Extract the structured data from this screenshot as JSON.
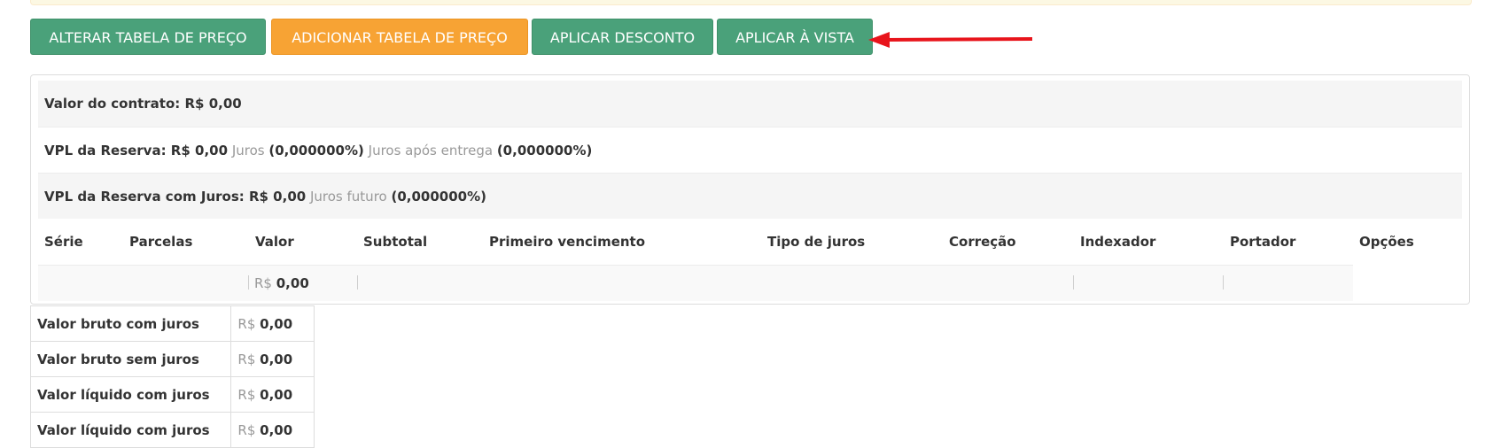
{
  "toolbar": {
    "alterar_label": "ALTERAR TABELA DE PREÇO",
    "adicionar_label": "ADICIONAR TABELA DE PREÇO",
    "desconto_label": "APLICAR DESCONTO",
    "avista_label": "APLICAR À VISTA",
    "colors": {
      "green": "#4aa17a",
      "orange": "#f7a334",
      "arrow": "#e8141b"
    }
  },
  "summary": {
    "contrato": "Valor do contrato: R$ 0,00",
    "vpl_reserva": "VPL da Reserva: R$ 0,00",
    "juros_label": "Juros",
    "juros_value": "(0,000000%)",
    "juros_entrega_label": "Juros após entrega",
    "juros_entrega_value": "(0,000000%)",
    "vpl_com_juros": "VPL da Reserva com Juros: R$ 0,00",
    "juros_futuro_label": "Juros futuro",
    "juros_futuro_value": "(0,000000%)"
  },
  "grid": {
    "columns": [
      "Série",
      "Parcelas",
      "Valor",
      "Subtotal",
      "Primeiro vencimento",
      "Tipo de juros",
      "Correção",
      "Indexador",
      "Portador",
      "Opções"
    ],
    "row": {
      "currency": "R$",
      "valor": "0,00"
    }
  },
  "totals": [
    {
      "label": "Valor bruto com juros",
      "currency": "R$",
      "value": "0,00"
    },
    {
      "label": "Valor bruto sem juros",
      "currency": "R$",
      "value": "0,00"
    },
    {
      "label": "Valor líquido com juros",
      "currency": "R$",
      "value": "0,00"
    },
    {
      "label": "Valor líquido com juros",
      "currency": "R$",
      "value": "0,00"
    }
  ]
}
